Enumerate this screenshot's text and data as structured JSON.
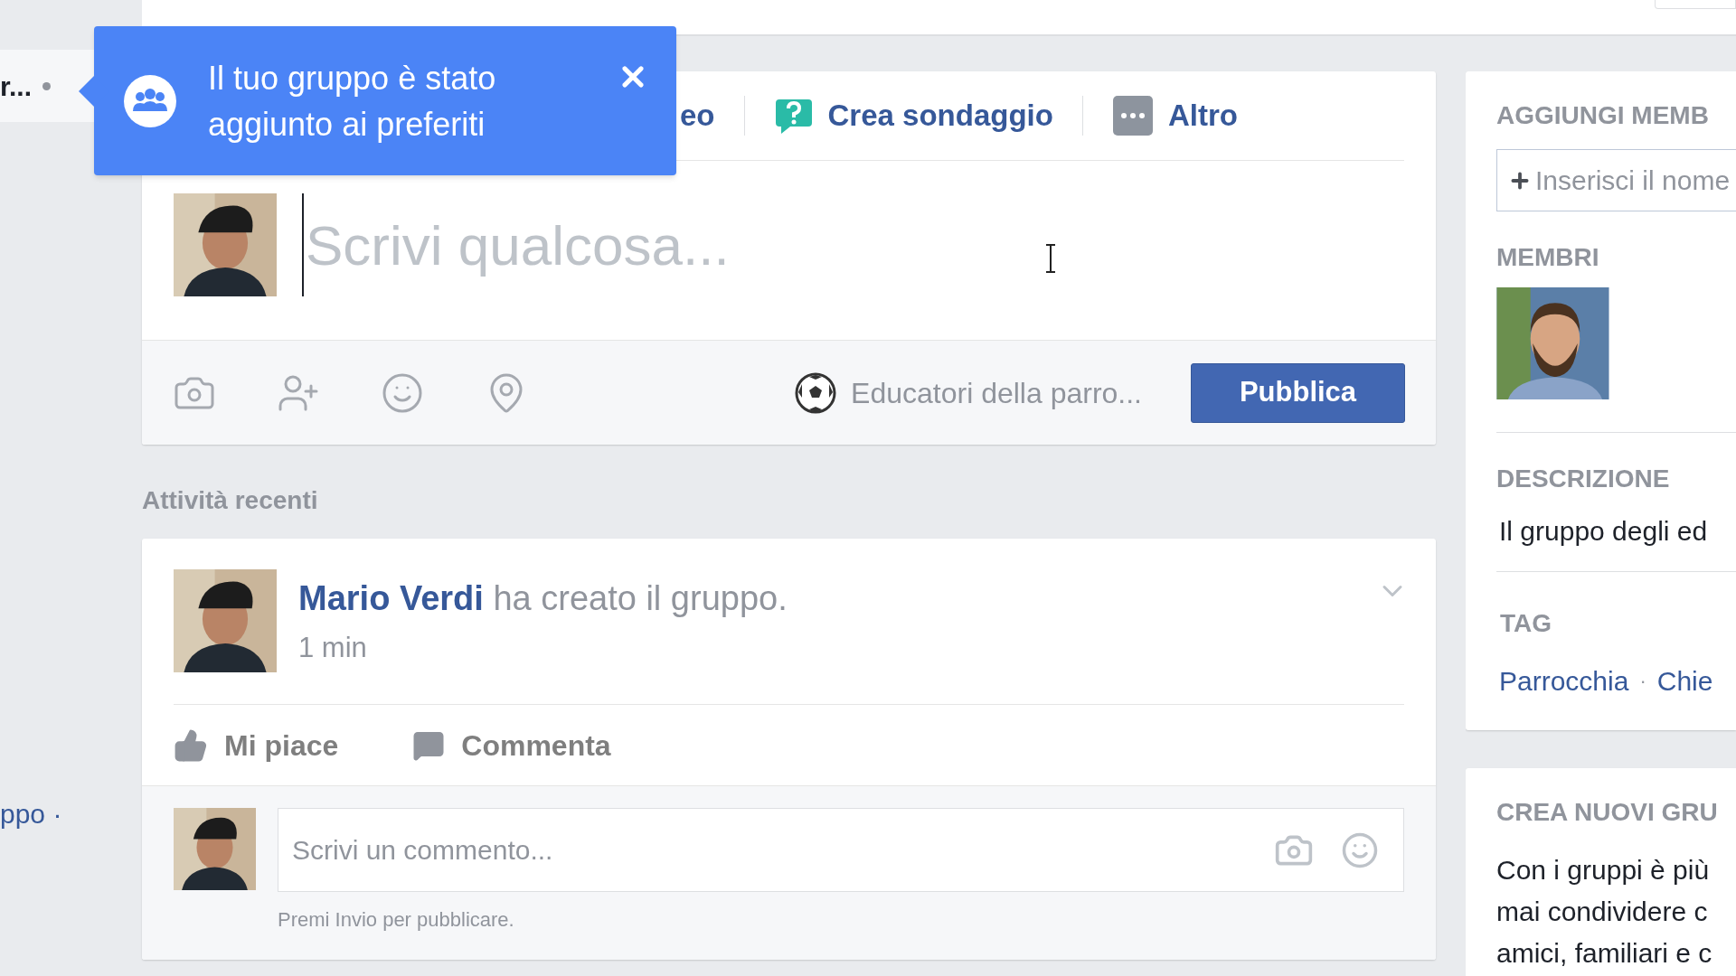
{
  "left_nav": {
    "items": [
      {
        "label": "r...",
        "selected": true
      },
      {
        "label": "ppo ·",
        "selected": false
      }
    ]
  },
  "toast": {
    "message": "Il tuo gruppo è stato aggiunto ai preferiti"
  },
  "composer": {
    "tabs": [
      {
        "label": "eo",
        "kind": "plain"
      },
      {
        "label": "Crea sondaggio",
        "kind": "poll"
      },
      {
        "label": "Altro",
        "kind": "more"
      }
    ],
    "placeholder": "Scrivi qualcosa...",
    "audience": "Educatori della parro...",
    "submit": "Pubblica"
  },
  "section_title": "Attività recenti",
  "post": {
    "author": "Mario Verdi",
    "action": "ha creato il gruppo.",
    "time": "1 min",
    "actions": [
      {
        "label": "Mi piace",
        "kind": "like"
      },
      {
        "label": "Commenta",
        "kind": "comment"
      }
    ],
    "comment_placeholder": "Scrivi un commento...",
    "hint": "Premi Invio per pubblicare."
  },
  "sidebar": {
    "add_title": "AGGIUNGI MEMB",
    "add_placeholder": "Inserisci il nome",
    "members_title": "MEMBRI",
    "description_title": "DESCRIZIONE",
    "description": "Il gruppo degli ed",
    "tags_title": "TAG",
    "tags": [
      "Parrocchia",
      "Chie"
    ],
    "tag_separator": "·"
  },
  "create": {
    "title": "CREA NUOVI GRU",
    "lines": [
      "Con i gruppi è più",
      "mai condividere c",
      "amici, familiari e c"
    ]
  }
}
